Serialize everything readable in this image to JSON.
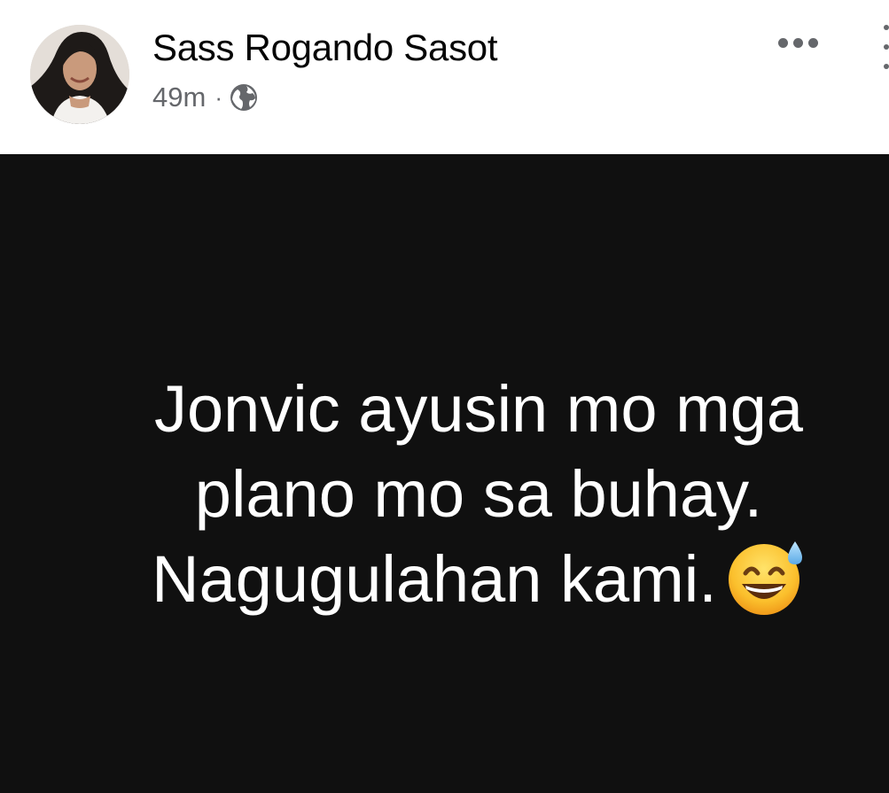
{
  "post": {
    "author_name": "Sass Rogando Sasot",
    "timestamp": "49m",
    "separator": "·",
    "privacy_icon": "globe-icon",
    "more_icon": "more-options-icon",
    "status_lines": [
      "Jonvic ayusin mo mga",
      "plano mo sa buhay.",
      "Nagugulahan kami."
    ],
    "emoji_icon": "grinning-sweat-emoji-icon"
  },
  "colors": {
    "header_bg": "#ffffff",
    "status_bg": "#101010",
    "status_text": "#ffffff",
    "author_text": "#050505",
    "meta_text": "#65676b"
  }
}
